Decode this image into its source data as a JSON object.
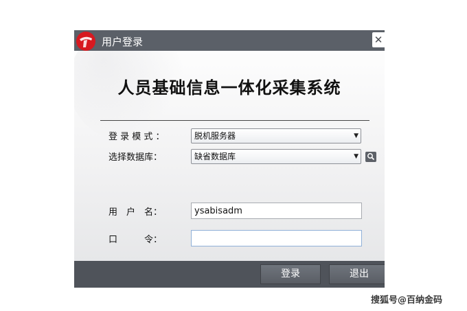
{
  "window": {
    "title": "用户登录",
    "close_glyph": "✕"
  },
  "header": {
    "app_title": "人员基础信息一体化采集系统"
  },
  "form": {
    "login_mode": {
      "label": "登 录 模 式 ：",
      "value": "脱机服务器"
    },
    "database": {
      "label": "选择数据库：",
      "value": "缺省数据库"
    },
    "username": {
      "label": "用　户　名：",
      "value": "ysabisadm"
    },
    "password": {
      "label": "口　　　令：",
      "value": ""
    }
  },
  "buttons": {
    "login": "登录",
    "exit": "退出"
  },
  "footer_watermark": "搜狐号@百纳金码",
  "colors": {
    "titlebar": "#5b6068",
    "footer": "#4f535a",
    "logo_red": "#d71920"
  }
}
